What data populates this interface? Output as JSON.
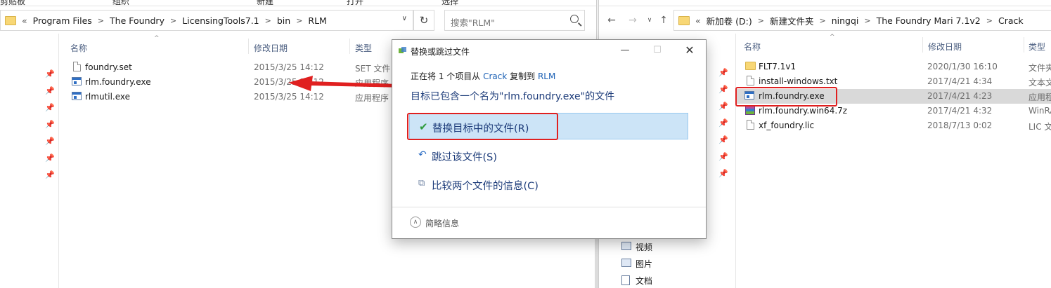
{
  "ribbon": {
    "left_label": "剪贴板",
    "items": [
      "组织",
      "新建",
      "打开",
      "选择"
    ]
  },
  "left_pane": {
    "path": [
      "Program Files",
      "The Foundry",
      "LicensingTools7.1",
      "bin",
      "RLM"
    ],
    "overflow_label": "«",
    "search_placeholder": "搜索\"RLM\"",
    "columns": {
      "name": "名称",
      "date": "修改日期",
      "type": "类型"
    },
    "files": [
      {
        "name": "foundry.set",
        "date": "2015/3/25 14:12",
        "type": "SET 文件",
        "icon": "document-icon"
      },
      {
        "name": "rlm.foundry.exe",
        "date": "2015/3/25 14:12",
        "type": "应用程序",
        "icon": "exe-icon"
      },
      {
        "name": "rlmutil.exe",
        "date": "2015/3/25 14:12",
        "type": "应用程序",
        "icon": "exe-icon"
      }
    ]
  },
  "right_pane": {
    "path": [
      "新加卷 (D:)",
      "新建文件夹",
      "ningqi",
      "The Foundry Mari 7.1v2",
      "Crack"
    ],
    "overflow_label": "«",
    "columns": {
      "name": "名称",
      "date": "修改日期",
      "type": "类型"
    },
    "files": [
      {
        "name": "FLT7.1v1",
        "date": "2020/1/30 16:10",
        "type": "文件夹",
        "icon": "folder-icon"
      },
      {
        "name": "install-windows.txt",
        "date": "2017/4/21 4:34",
        "type": "文本文",
        "icon": "document-icon"
      },
      {
        "name": "rlm.foundry.exe",
        "date": "2017/4/21 4:23",
        "type": "应用程",
        "icon": "exe-icon",
        "selected": true
      },
      {
        "name": "rlm.foundry.win64.7z",
        "date": "2017/4/21 4:32",
        "type": "WinRA",
        "icon": "zip-icon"
      },
      {
        "name": "xf_foundry.lic",
        "date": "2018/7/13 0:02",
        "type": "LIC 文件",
        "icon": "document-icon"
      }
    ],
    "nav_items": [
      {
        "label": "视频",
        "icon": "video-icon"
      },
      {
        "label": "图片",
        "icon": "pictures-icon"
      },
      {
        "label": "文档",
        "icon": "documents-icon"
      }
    ]
  },
  "dialog": {
    "title": "替换或跳过文件",
    "line1_prefix": "正在将 1 个项目从 ",
    "source": "Crack",
    "line1_mid": " 复制到 ",
    "destination": "RLM",
    "heading": "目标已包含一个名为\"rlm.foundry.exe\"的文件",
    "options": [
      {
        "label": "替换目标中的文件(R)",
        "icon": "check-icon",
        "selected": true
      },
      {
        "label": "跳过该文件(S)",
        "icon": "skip-icon",
        "selected": false
      },
      {
        "label": "比较两个文件的信息(C)",
        "icon": "compare-icon",
        "selected": false
      }
    ],
    "footer": "简略信息"
  },
  "colors": {
    "annotation_red": "#e02020",
    "selection_blue": "#cce4f7",
    "link_blue": "#1a5fb4"
  }
}
